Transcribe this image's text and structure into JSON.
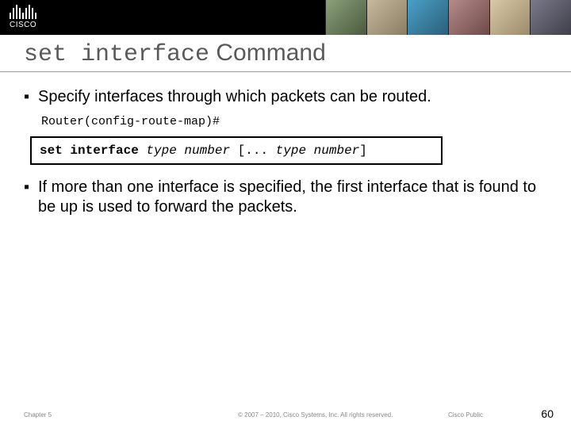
{
  "title": {
    "command": "set interface",
    "word": " Command"
  },
  "bullets": {
    "b1": "Specify interfaces through which packets can be routed.",
    "b2": "If more than one interface is specified, the first interface that is found to be up is used to forward the packets."
  },
  "prompt": "Router(config-route-map)#",
  "cmd": {
    "kw": "set interface ",
    "arg1": "type number",
    "mid": " [... ",
    "arg2": "type number",
    "end": "]"
  },
  "footer": {
    "chapter": "Chapter 5",
    "copyright": "© 2007 – 2010, Cisco Systems, Inc. All rights reserved.",
    "public": "Cisco Public",
    "page": "60"
  },
  "logo_text": "CISCO"
}
